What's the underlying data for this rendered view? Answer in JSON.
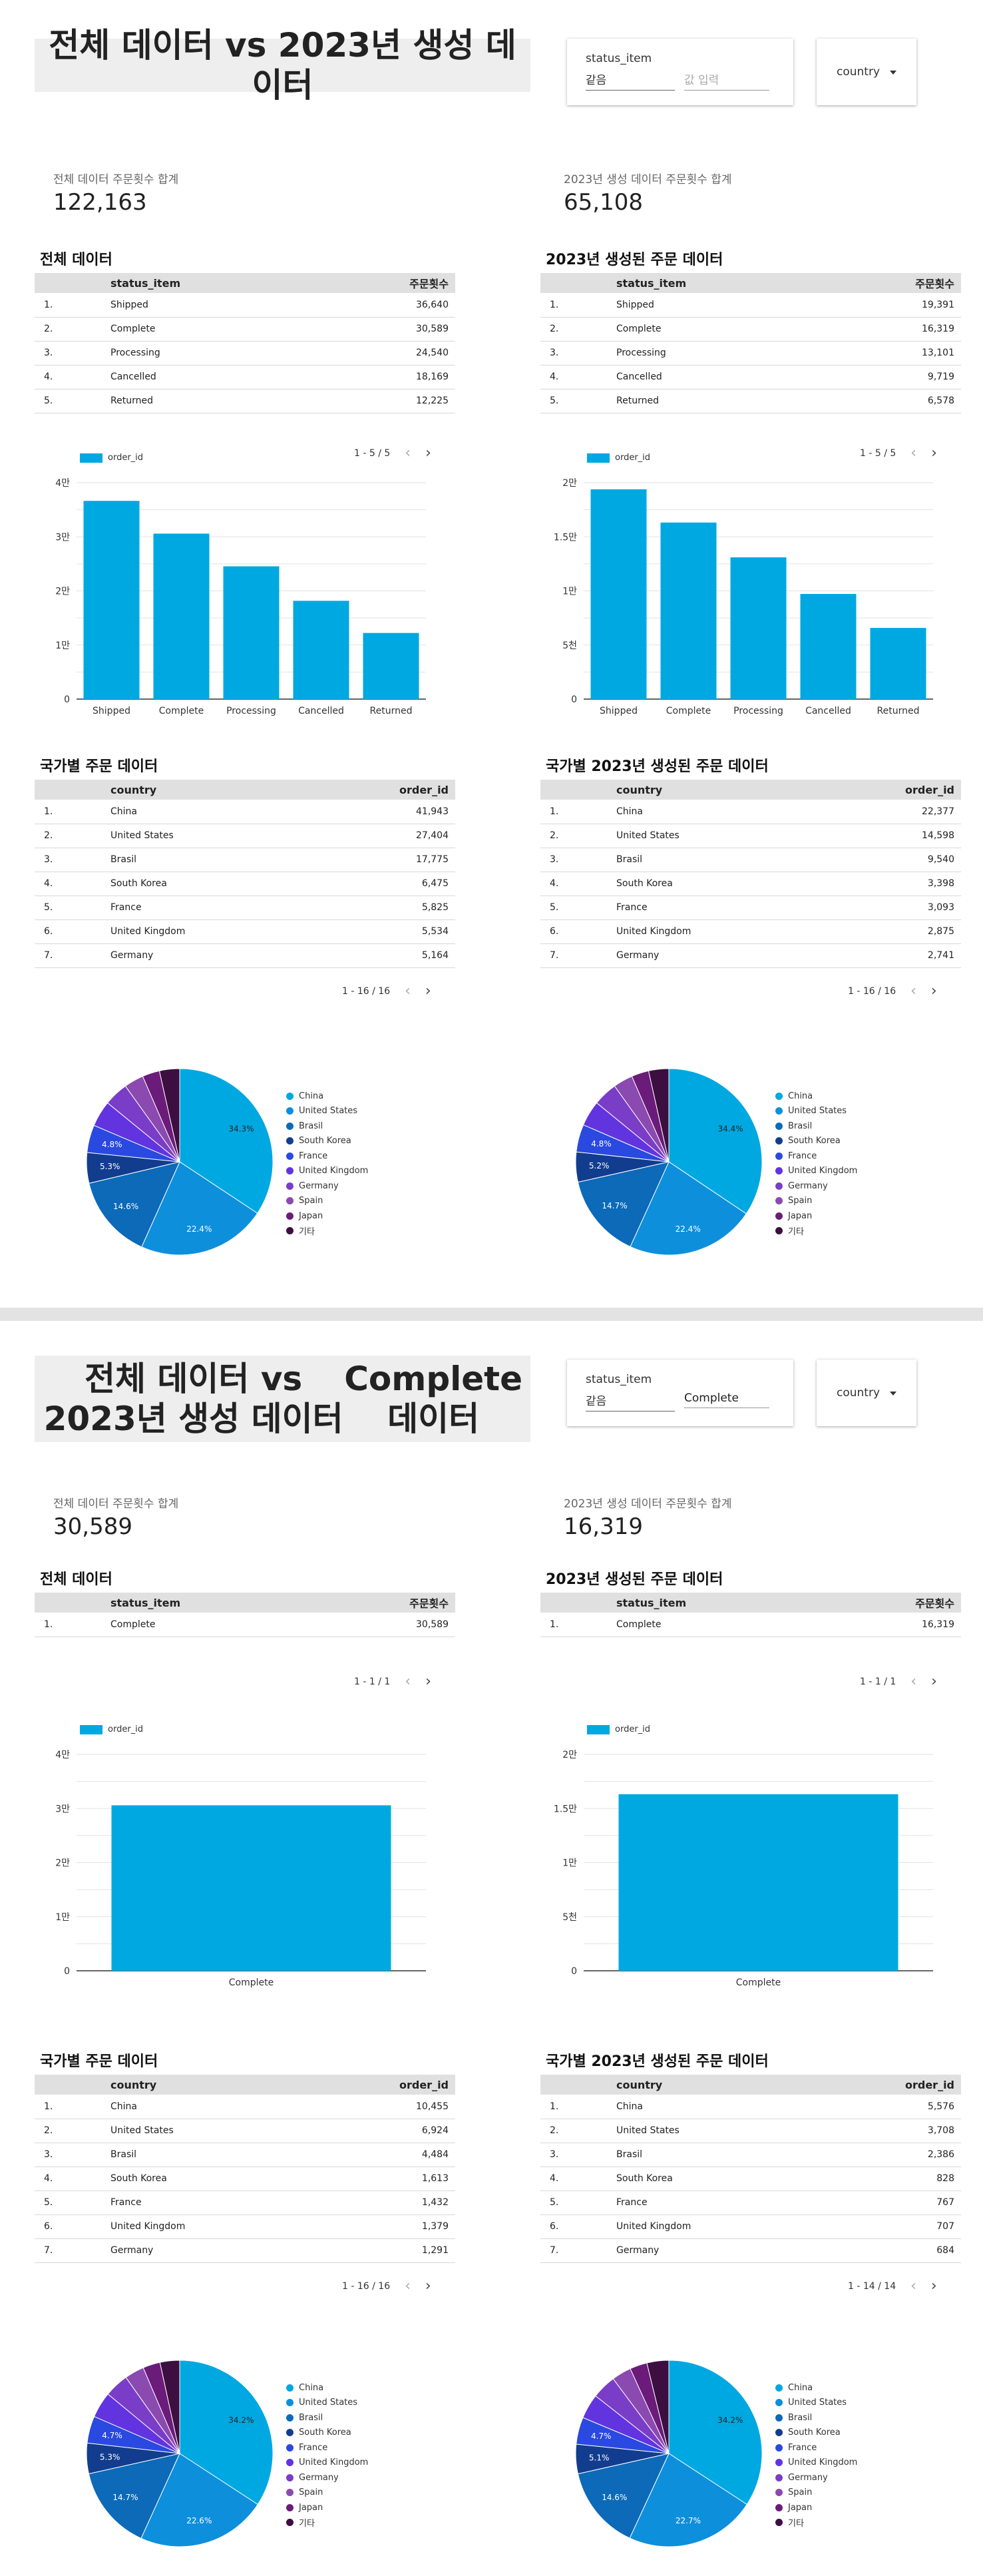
{
  "colors": {
    "bar": "#00a8e1",
    "pie": [
      "#00a8e1",
      "#0e8fdc",
      "#0c6ab8",
      "#123d8f",
      "#2a49e0",
      "#6234e0",
      "#7a3dc7",
      "#8a4ab0",
      "#6b1b7a",
      "#3c0f40"
    ]
  },
  "pages": [
    {
      "title_lines": [
        "전체 데이터 vs 2023년 생성 데이터"
      ],
      "filter": {
        "label": "status_item",
        "operator": "같음",
        "value": "",
        "placeholder": "값 입력"
      },
      "country_filter": {
        "label": "country"
      },
      "kpis": [
        {
          "label": "전체 데이터 주문횟수 합계",
          "value": "122,163"
        },
        {
          "label": "2023년 생성 데이터 주문횟수 합계",
          "value": "65,108"
        }
      ],
      "status_tables": [
        {
          "title": "전체 데이터",
          "headers": [
            "status_item",
            "주문횟수"
          ],
          "rows": [
            [
              "1.",
              "Shipped",
              "36,640"
            ],
            [
              "2.",
              "Complete",
              "30,589"
            ],
            [
              "3.",
              "Processing",
              "24,540"
            ],
            [
              "4.",
              "Cancelled",
              "18,169"
            ],
            [
              "5.",
              "Returned",
              "12,225"
            ]
          ],
          "pager": "1 - 5 / 5"
        },
        {
          "title": "2023년 생성된 주문 데이터",
          "headers": [
            "status_item",
            "주문횟수"
          ],
          "rows": [
            [
              "1.",
              "Shipped",
              "19,391"
            ],
            [
              "2.",
              "Complete",
              "16,319"
            ],
            [
              "3.",
              "Processing",
              "13,101"
            ],
            [
              "4.",
              "Cancelled",
              "9,719"
            ],
            [
              "5.",
              "Returned",
              "6,578"
            ]
          ],
          "pager": "1 - 5 / 5"
        }
      ],
      "country_tables": [
        {
          "title": "국가별 주문 데이터",
          "headers": [
            "country",
            "order_id"
          ],
          "rows": [
            [
              "1.",
              "China",
              "41,943"
            ],
            [
              "2.",
              "United States",
              "27,404"
            ],
            [
              "3.",
              "Brasil",
              "17,775"
            ],
            [
              "4.",
              "South Korea",
              "6,475"
            ],
            [
              "5.",
              "France",
              "5,825"
            ],
            [
              "6.",
              "United Kingdom",
              "5,534"
            ],
            [
              "7.",
              "Germany",
              "5,164"
            ]
          ],
          "pager": "1 - 16 / 16"
        },
        {
          "title": "국가별 2023년 생성된 주문 데이터",
          "headers": [
            "country",
            "order_id"
          ],
          "rows": [
            [
              "1.",
              "China",
              "22,377"
            ],
            [
              "2.",
              "United States",
              "14,598"
            ],
            [
              "3.",
              "Brasil",
              "9,540"
            ],
            [
              "4.",
              "South Korea",
              "3,398"
            ],
            [
              "5.",
              "France",
              "3,093"
            ],
            [
              "6.",
              "United Kingdom",
              "2,875"
            ],
            [
              "7.",
              "Germany",
              "2,741"
            ]
          ],
          "pager": "1 - 16 / 16"
        }
      ]
    },
    {
      "title_lines": [
        "전체 데이터 vs 2023년 생성 데이터",
        "Complete 데이터"
      ],
      "filter": {
        "label": "status_item",
        "operator": "같음",
        "value": "Complete",
        "placeholder": ""
      },
      "country_filter": {
        "label": "country"
      },
      "kpis": [
        {
          "label": "전체 데이터 주문횟수 합계",
          "value": "30,589"
        },
        {
          "label": "2023년 생성 데이터 주문횟수 합계",
          "value": "16,319"
        }
      ],
      "status_tables": [
        {
          "title": "전체 데이터",
          "headers": [
            "status_item",
            "주문횟수"
          ],
          "rows": [
            [
              "1.",
              "Complete",
              "30,589"
            ]
          ],
          "pager": "1 - 1 / 1"
        },
        {
          "title": "2023년 생성된 주문 데이터",
          "headers": [
            "status_item",
            "주문횟수"
          ],
          "rows": [
            [
              "1.",
              "Complete",
              "16,319"
            ]
          ],
          "pager": "1 - 1 / 1"
        }
      ],
      "country_tables": [
        {
          "title": "국가별 주문 데이터",
          "headers": [
            "country",
            "order_id"
          ],
          "rows": [
            [
              "1.",
              "China",
              "10,455"
            ],
            [
              "2.",
              "United States",
              "6,924"
            ],
            [
              "3.",
              "Brasil",
              "4,484"
            ],
            [
              "4.",
              "South Korea",
              "1,613"
            ],
            [
              "5.",
              "France",
              "1,432"
            ],
            [
              "6.",
              "United Kingdom",
              "1,379"
            ],
            [
              "7.",
              "Germany",
              "1,291"
            ]
          ],
          "pager": "1 - 16 / 16"
        },
        {
          "title": "국가별 2023년 생성된 주문 데이터",
          "headers": [
            "country",
            "order_id"
          ],
          "rows": [
            [
              "1.",
              "China",
              "5,576"
            ],
            [
              "2.",
              "United States",
              "3,708"
            ],
            [
              "3.",
              "Brasil",
              "2,386"
            ],
            [
              "4.",
              "South Korea",
              "828"
            ],
            [
              "5.",
              "France",
              "767"
            ],
            [
              "6.",
              "United Kingdom",
              "707"
            ],
            [
              "7.",
              "Germany",
              "684"
            ]
          ],
          "pager": "1 - 14 / 14"
        }
      ]
    }
  ],
  "chart_data": [
    {
      "type": "bar",
      "legend": "order_id",
      "categories": [
        "Shipped",
        "Complete",
        "Processing",
        "Cancelled",
        "Returned"
      ],
      "values": [
        36640,
        30589,
        24540,
        18169,
        12225
      ],
      "ylim": [
        0,
        40000
      ],
      "yticks": [
        0,
        10000,
        20000,
        30000,
        40000
      ],
      "ytick_labels": [
        "0",
        "1만",
        "2만",
        "3만",
        "4만"
      ],
      "grid": true
    },
    {
      "type": "bar",
      "legend": "order_id",
      "categories": [
        "Shipped",
        "Complete",
        "Processing",
        "Cancelled",
        "Returned"
      ],
      "values": [
        19391,
        16319,
        13101,
        9719,
        6578
      ],
      "ylim": [
        0,
        20000
      ],
      "yticks": [
        0,
        5000,
        10000,
        15000,
        20000
      ],
      "ytick_labels": [
        "0",
        "5천",
        "1만",
        "1.5만",
        "2만"
      ],
      "grid": true
    },
    {
      "type": "pie",
      "legend_position": "right",
      "labels": [
        "China",
        "United States",
        "Brasil",
        "South Korea",
        "France",
        "United Kingdom",
        "Germany",
        "Spain",
        "Japan",
        "기타"
      ],
      "values": [
        34.3,
        22.4,
        14.6,
        5.3,
        4.8,
        4.5,
        4.2,
        3.4,
        3.0,
        3.5
      ],
      "slice_labels": [
        "34.3%",
        "22.4%",
        "14.6%",
        "5.3%",
        "4.8%",
        "",
        "",
        "",
        "",
        ""
      ]
    },
    {
      "type": "pie",
      "legend_position": "right",
      "labels": [
        "China",
        "United States",
        "Brasil",
        "South Korea",
        "France",
        "United Kingdom",
        "Germany",
        "Spain",
        "Japan",
        "기타"
      ],
      "values": [
        34.4,
        22.4,
        14.7,
        5.2,
        4.8,
        4.4,
        4.2,
        3.4,
        3.0,
        3.5
      ],
      "slice_labels": [
        "34.4%",
        "22.4%",
        "14.7%",
        "5.2%",
        "4.8%",
        "",
        "",
        "",
        "",
        ""
      ]
    },
    {
      "type": "bar",
      "legend": "order_id",
      "categories": [
        "Complete"
      ],
      "values": [
        30589
      ],
      "ylim": [
        0,
        40000
      ],
      "yticks": [
        0,
        10000,
        20000,
        30000,
        40000
      ],
      "ytick_labels": [
        "0",
        "1만",
        "2만",
        "3만",
        "4만"
      ],
      "grid": true
    },
    {
      "type": "bar",
      "legend": "order_id",
      "categories": [
        "Complete"
      ],
      "values": [
        16319
      ],
      "ylim": [
        0,
        20000
      ],
      "yticks": [
        0,
        5000,
        10000,
        15000,
        20000
      ],
      "ytick_labels": [
        "0",
        "5천",
        "1만",
        "1.5만",
        "2만"
      ],
      "grid": true
    },
    {
      "type": "pie",
      "legend_position": "right",
      "labels": [
        "China",
        "United States",
        "Brasil",
        "South Korea",
        "France",
        "United Kingdom",
        "Germany",
        "Spain",
        "Japan",
        "기타"
      ],
      "values": [
        34.2,
        22.6,
        14.7,
        5.3,
        4.7,
        4.5,
        4.2,
        3.4,
        3.0,
        3.4
      ],
      "slice_labels": [
        "34.2%",
        "22.6%",
        "14.7%",
        "5.3%",
        "4.7%",
        "",
        "",
        "",
        "",
        ""
      ]
    },
    {
      "type": "pie",
      "legend_position": "right",
      "labels": [
        "China",
        "United States",
        "Brasil",
        "South Korea",
        "France",
        "United Kingdom",
        "Germany",
        "Spain",
        "Japan",
        "기타"
      ],
      "values": [
        34.2,
        22.7,
        14.6,
        5.1,
        4.7,
        4.3,
        4.2,
        3.4,
        3.0,
        3.8
      ],
      "slice_labels": [
        "34.2%",
        "22.7%",
        "14.6%",
        "5.1%",
        "4.7%",
        "",
        "",
        "",
        "",
        ""
      ]
    }
  ]
}
